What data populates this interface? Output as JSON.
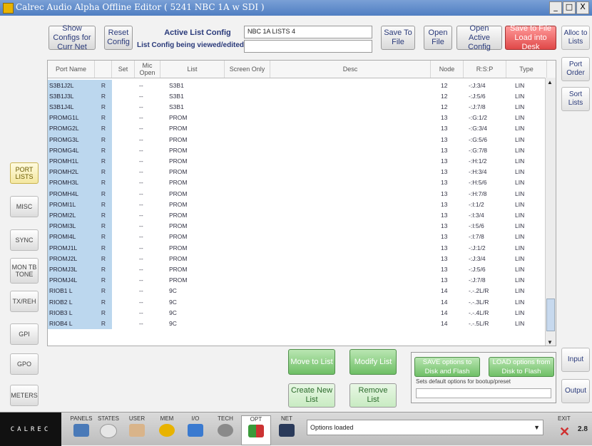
{
  "window": {
    "title": "Calrec Audio Alpha Offline Editor  ( 5241 NBC 1A w SDI )",
    "controls": [
      "_",
      "□",
      "X"
    ]
  },
  "toolbar": {
    "show_configs_label": "Show Configs for Curr Net",
    "reset_config_label": "Reset Config",
    "active_list_config_heading": "Active List Config",
    "active_list_config_value": "NBC 1A LISTS 4",
    "list_config_viewed_heading": "List Config being viewed/edited",
    "list_config_viewed_value": "",
    "save_to_file_label": "Save To File",
    "open_file_label": "Open File",
    "open_active_config_label": "Open Active Config",
    "save_to_file_load_label": "Save to File Load into Desk"
  },
  "table": {
    "columns": [
      "Port Name",
      "",
      "Set",
      "Mic Open",
      "List",
      "Screen Only",
      "Desc",
      "Node",
      "R:S:P",
      "Type"
    ],
    "rows": [
      {
        "name": "S3B1J2L",
        "r": "R",
        "mic": "--",
        "list": "S3B1",
        "node": "12",
        "rsp": "-:J:3/4",
        "type": "LIN"
      },
      {
        "name": "S3B1J3L",
        "r": "R",
        "mic": "--",
        "list": "S3B1",
        "node": "12",
        "rsp": "-:J:5/6",
        "type": "LIN"
      },
      {
        "name": "S3B1J4L",
        "r": "R",
        "mic": "--",
        "list": "S3B1",
        "node": "12",
        "rsp": "-:J:7/8",
        "type": "LIN"
      },
      {
        "name": "PROMG1L",
        "r": "R",
        "mic": "--",
        "list": "PROM",
        "node": "13",
        "rsp": "-:G:1/2",
        "type": "LIN"
      },
      {
        "name": "PROMG2L",
        "r": "R",
        "mic": "--",
        "list": "PROM",
        "node": "13",
        "rsp": "-:G:3/4",
        "type": "LIN"
      },
      {
        "name": "PROMG3L",
        "r": "R",
        "mic": "--",
        "list": "PROM",
        "node": "13",
        "rsp": "-:G:5/6",
        "type": "LIN"
      },
      {
        "name": "PROMG4L",
        "r": "R",
        "mic": "--",
        "list": "PROM",
        "node": "13",
        "rsp": "-:G:7/8",
        "type": "LIN"
      },
      {
        "name": "PROMH1L",
        "r": "R",
        "mic": "--",
        "list": "PROM",
        "node": "13",
        "rsp": "-:H:1/2",
        "type": "LIN"
      },
      {
        "name": "PROMH2L",
        "r": "R",
        "mic": "--",
        "list": "PROM",
        "node": "13",
        "rsp": "-:H:3/4",
        "type": "LIN"
      },
      {
        "name": "PROMH3L",
        "r": "R",
        "mic": "--",
        "list": "PROM",
        "node": "13",
        "rsp": "-:H:5/6",
        "type": "LIN"
      },
      {
        "name": "PROMH4L",
        "r": "R",
        "mic": "--",
        "list": "PROM",
        "node": "13",
        "rsp": "-:H:7/8",
        "type": "LIN"
      },
      {
        "name": "PROMI1L",
        "r": "R",
        "mic": "--",
        "list": "PROM",
        "node": "13",
        "rsp": "-:I:1/2",
        "type": "LIN"
      },
      {
        "name": "PROMI2L",
        "r": "R",
        "mic": "--",
        "list": "PROM",
        "node": "13",
        "rsp": "-:I:3/4",
        "type": "LIN"
      },
      {
        "name": "PROMI3L",
        "r": "R",
        "mic": "--",
        "list": "PROM",
        "node": "13",
        "rsp": "-:I:5/6",
        "type": "LIN"
      },
      {
        "name": "PROMI4L",
        "r": "R",
        "mic": "--",
        "list": "PROM",
        "node": "13",
        "rsp": "-:I:7/8",
        "type": "LIN"
      },
      {
        "name": "PROMJ1L",
        "r": "R",
        "mic": "--",
        "list": "PROM",
        "node": "13",
        "rsp": "-:J:1/2",
        "type": "LIN"
      },
      {
        "name": "PROMJ2L",
        "r": "R",
        "mic": "--",
        "list": "PROM",
        "node": "13",
        "rsp": "-:J:3/4",
        "type": "LIN"
      },
      {
        "name": "PROMJ3L",
        "r": "R",
        "mic": "--",
        "list": "PROM",
        "node": "13",
        "rsp": "-:J:5/6",
        "type": "LIN"
      },
      {
        "name": "PROMJ4L",
        "r": "R",
        "mic": "--",
        "list": "PROM",
        "node": "13",
        "rsp": "-:J:7/8",
        "type": "LIN"
      },
      {
        "name": "RIOB1 L",
        "r": "R",
        "mic": "--",
        "list": "9C",
        "node": "14",
        "rsp": "-.-.2L/R",
        "type": "LIN"
      },
      {
        "name": "RIOB2 L",
        "r": "R",
        "mic": "--",
        "list": "9C",
        "node": "14",
        "rsp": "-.-.3L/R",
        "type": "LIN"
      },
      {
        "name": "RIOB3 L",
        "r": "R",
        "mic": "--",
        "list": "9C",
        "node": "14",
        "rsp": "-.-.4L/R",
        "type": "LIN"
      },
      {
        "name": "RIOB4 L",
        "r": "R",
        "mic": "--",
        "list": "9C",
        "node": "14",
        "rsp": "-.-.5L/R",
        "type": "LIN"
      }
    ]
  },
  "sidebar": {
    "items": [
      "PORT LISTS",
      "MISC",
      "SYNC",
      "MON TB TONE",
      "TX/REH",
      "GPI",
      "GPO",
      "METERS"
    ],
    "active": "PORT LISTS"
  },
  "right": {
    "alloc_to_lists": "Alloc to Lists",
    "port_order": "Port Order",
    "sort_lists": "Sort Lists",
    "input": "Input",
    "output": "Output"
  },
  "actions": {
    "move_to_list": "Move to List",
    "modify_list": "Modify List",
    "create_new_list": "Create New List",
    "remove_list": "Remove List",
    "save_options": "SAVE options to Disk and Flash",
    "load_options": "LOAD options from Disk to Flash",
    "default_options_note": "Sets default options for bootup/preset"
  },
  "bottom": {
    "logo": "CALREC",
    "items": [
      "PANELS",
      "STATES",
      "USER",
      "MEM",
      "I/O",
      "TECH",
      "OPT",
      "NET"
    ],
    "active": "OPT",
    "status_text": "Options loaded",
    "exit_label": "EXIT",
    "version": "2.8"
  },
  "colors": {
    "accent_blue": "#bcd7ee",
    "green": "#6fbf66",
    "red": "#e04848",
    "title": "#4f7ec2"
  }
}
